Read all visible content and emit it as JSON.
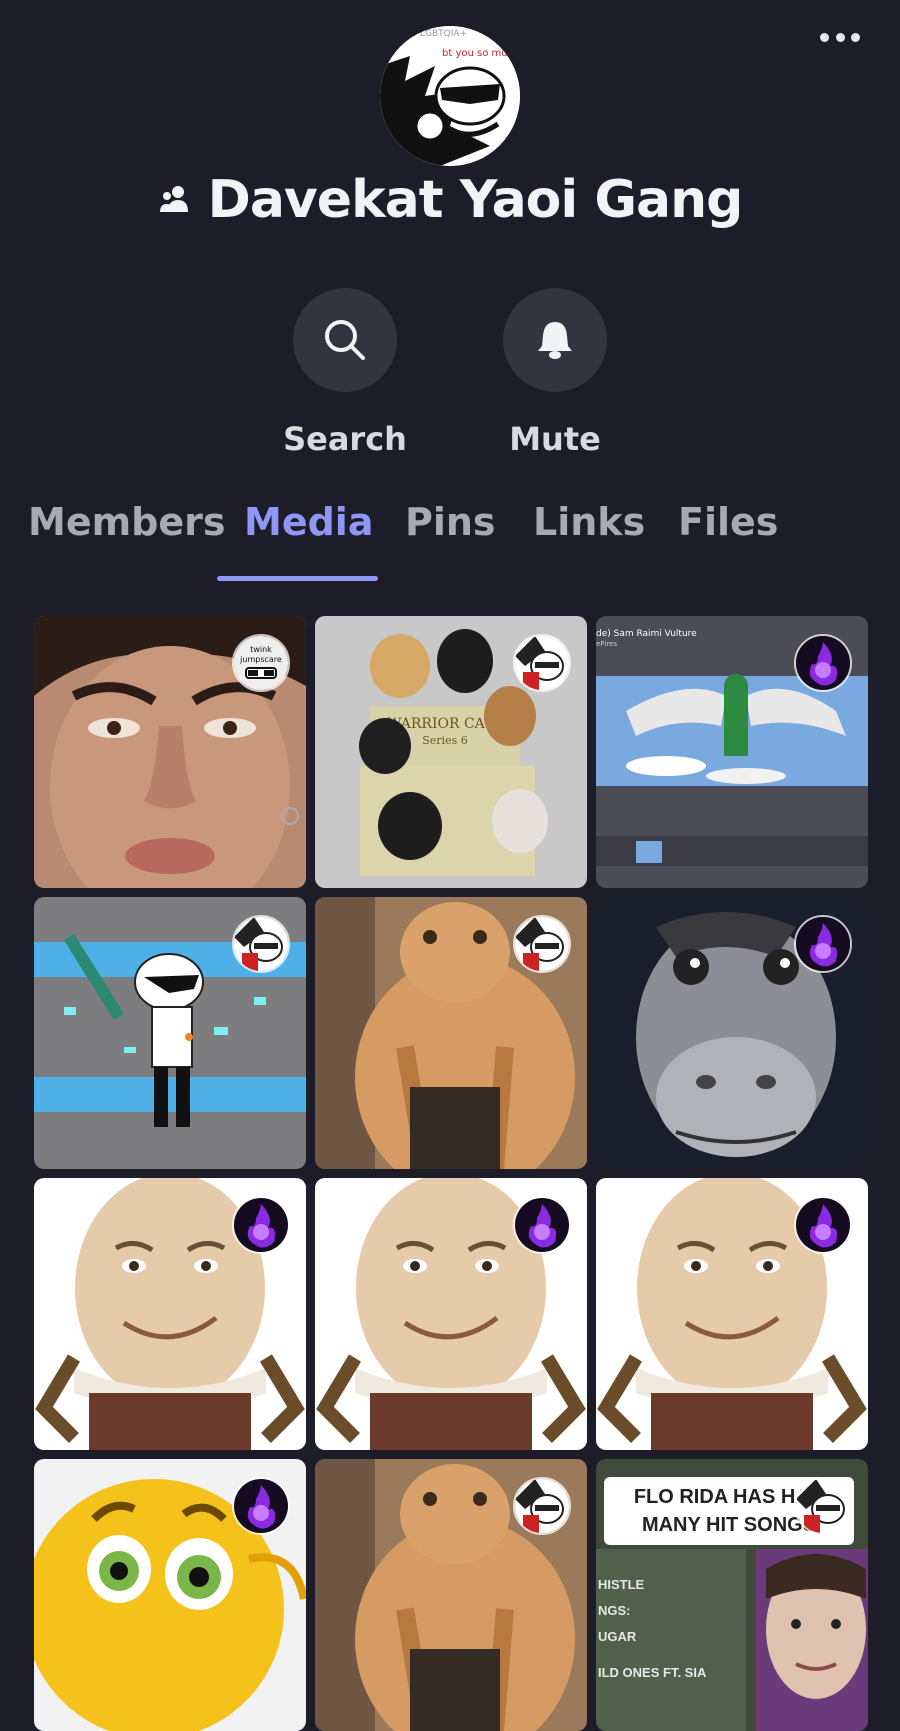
{
  "header": {
    "group_name": "Davekat Yaoi Gang",
    "avatar_text_top": "LGBTQIA+",
    "avatar_text_red": "bt you so muc"
  },
  "actions": {
    "search_label": "Search",
    "mute_label": "Mute"
  },
  "tabs": [
    {
      "label": "Members",
      "active": false
    },
    {
      "label": "Media",
      "active": true
    },
    {
      "label": "Pins",
      "active": false
    },
    {
      "label": "Links",
      "active": false
    },
    {
      "label": "Files",
      "active": false
    }
  ],
  "media": [
    {
      "subject": "crying-face-photo",
      "sender": "twink-jumpscare-avatar",
      "sender_text": [
        "twink",
        "jumpscare"
      ]
    },
    {
      "subject": "warrior-cats-figurines",
      "sender": "skull-avatar",
      "box_text": [
        "WARRIOR CATS",
        "Series 6"
      ]
    },
    {
      "subject": "lego-vulture-video",
      "sender": "purple-fire-avatar",
      "video_title": "de) Sam Raimi Vulture",
      "video_channel": "ePires"
    },
    {
      "subject": "cartoon-character-with-sword",
      "sender": "skull-avatar"
    },
    {
      "subject": "orange-cat",
      "sender": "skull-avatar"
    },
    {
      "subject": "donkey-face",
      "sender": "purple-fire-avatar"
    },
    {
      "subject": "humpty-dumpty",
      "sender": "purple-fire-avatar"
    },
    {
      "subject": "humpty-dumpty",
      "sender": "purple-fire-avatar"
    },
    {
      "subject": "humpty-dumpty",
      "sender": "purple-fire-avatar"
    },
    {
      "subject": "emoji-face",
      "sender": "purple-fire-avatar"
    },
    {
      "subject": "orange-cat",
      "sender": "skull-avatar"
    },
    {
      "subject": "flo-rida-meme",
      "sender": "skull-avatar",
      "caption": [
        "FLO RIDA HAS HAD",
        "MANY HIT SONGS"
      ],
      "lyrics": [
        "HISTLE",
        "NGS:",
        "UGAR",
        "ILD ONES FT. SIA"
      ]
    }
  ],
  "colors": {
    "background": "#1c1d28",
    "accent": "#8f97f5",
    "button_bg": "#32343f"
  }
}
